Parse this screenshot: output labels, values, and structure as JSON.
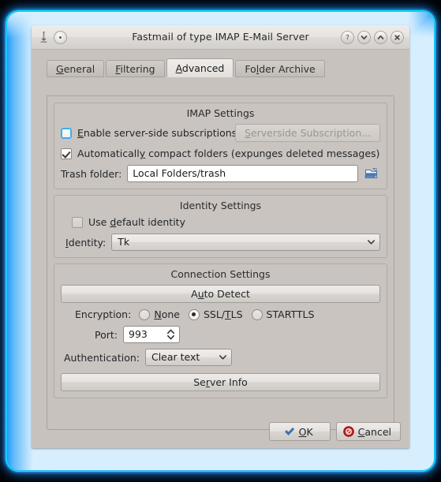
{
  "window": {
    "title": "Fastmail of type IMAP E-Mail Server",
    "titlebar_buttons": [
      {
        "name": "keep-above-icon",
        "label": ""
      },
      {
        "name": "on-all-desktops-button",
        "label": ""
      },
      {
        "name": "help-button",
        "label": "?"
      },
      {
        "name": "shade-button",
        "label": "v"
      },
      {
        "name": "maximize-button",
        "label": "^"
      },
      {
        "name": "close-button",
        "label": "x"
      }
    ]
  },
  "tabs": [
    {
      "label": "General",
      "selected": false
    },
    {
      "label": "Filtering",
      "selected": false
    },
    {
      "label": "Advanced",
      "selected": true
    },
    {
      "label": "Folder Archive",
      "selected": false
    }
  ],
  "imap_settings": {
    "title": "IMAP Settings",
    "enable_serverside_subscriptions": {
      "label": "Enable server-side subscriptions",
      "checked": false
    },
    "serverside_subscription_button": {
      "label": "Serverside Subscription...",
      "enabled": false
    },
    "auto_compact": {
      "label": "Automatically compact folders (expunges deleted messages)",
      "checked": true
    },
    "trash_folder": {
      "label": "Trash folder:",
      "value": "Local Folders/trash",
      "browse_icon": "open-folder-icon"
    }
  },
  "identity_settings": {
    "title": "Identity Settings",
    "use_default_identity": {
      "label": "Use default identity",
      "checked": false
    },
    "identity": {
      "label": "Identity:",
      "value": "Tk"
    }
  },
  "connection_settings": {
    "title": "Connection Settings",
    "auto_detect_button": "Auto Detect",
    "encryption": {
      "label": "Encryption:",
      "options": [
        "None",
        "SSL/TLS",
        "STARTTLS"
      ],
      "selected": "SSL/TLS"
    },
    "port": {
      "label": "Port:",
      "value": "993"
    },
    "authentication": {
      "label": "Authentication:",
      "value": "Clear text"
    },
    "server_info_button": "Server Info"
  },
  "dialog_buttons": {
    "ok": "OK",
    "cancel": "Cancel"
  },
  "colors": {
    "dialog_bg": "#c8c2be",
    "titlebar_bg": "#e6e3e0",
    "accent": "#3daee9",
    "glow": "#2aa8f5",
    "ok_icon": "#3b74b0",
    "cancel_icon": "#c4201c"
  }
}
